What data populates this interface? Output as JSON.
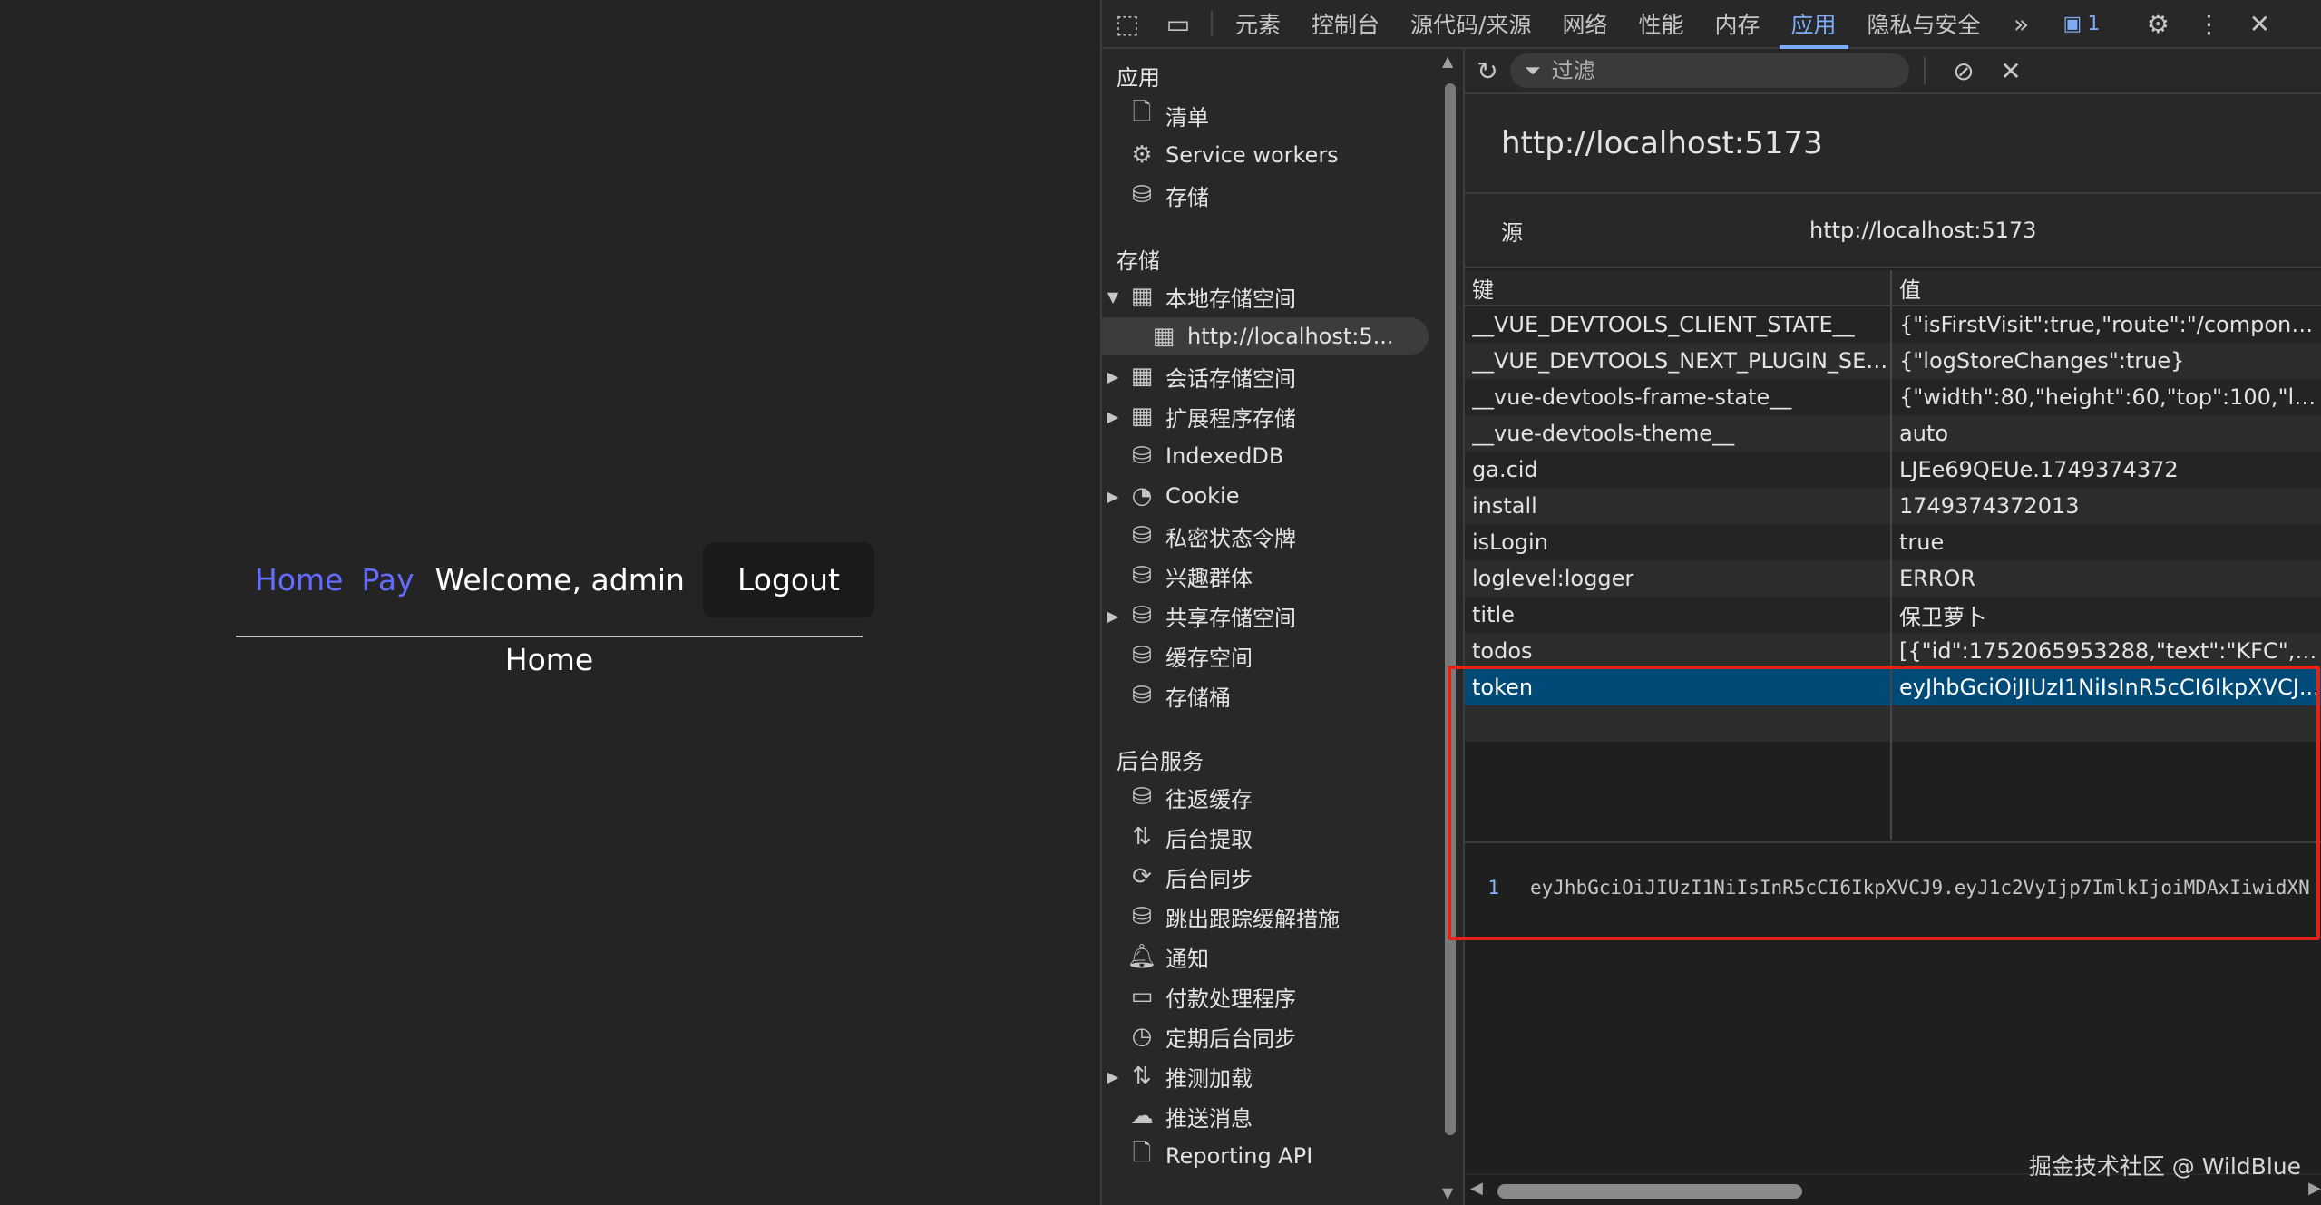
{
  "webpage": {
    "nav": {
      "home_link": "Home",
      "pay_link": "Pay",
      "welcome_text": "Welcome, admin",
      "logout_label": "Logout"
    },
    "heading": "Home",
    "colors": {
      "link": "#646cff",
      "background": "#242424",
      "button_bg": "#1a1a1a"
    }
  },
  "devtools": {
    "toolbar": {
      "inspect_icon": "inspect-element-icon",
      "device_icon": "device-toolbar-icon",
      "tabs": [
        "元素",
        "控制台",
        "源代码/来源",
        "网络",
        "性能",
        "内存",
        "应用",
        "隐私与安全"
      ],
      "active_tab": "应用",
      "more_tabs": "»",
      "issues_count": "1"
    },
    "sidebar": {
      "sections": [
        {
          "title": "应用",
          "items": [
            {
              "label": "清单",
              "icon": "file-icon"
            },
            {
              "label": "Service workers",
              "icon": "gears-icon"
            },
            {
              "label": "存储",
              "icon": "database-icon"
            }
          ]
        },
        {
          "title": "存储",
          "items": [
            {
              "label": "本地存储空间",
              "icon": "table-icon",
              "expanded": true
            },
            {
              "label": "http://localhost:5...",
              "icon": "table-icon",
              "selected": true
            },
            {
              "label": "会话存储空间",
              "icon": "table-icon"
            },
            {
              "label": "扩展程序存储",
              "icon": "table-icon"
            },
            {
              "label": "IndexedDB",
              "icon": "database-icon"
            },
            {
              "label": "Cookie",
              "icon": "cookie-icon"
            },
            {
              "label": "私密状态令牌",
              "icon": "database-icon"
            },
            {
              "label": "兴趣群体",
              "icon": "database-icon"
            },
            {
              "label": "共享存储空间",
              "icon": "database-icon"
            },
            {
              "label": "缓存空间",
              "icon": "database-icon"
            },
            {
              "label": "存储桶",
              "icon": "database-icon"
            }
          ]
        },
        {
          "title": "后台服务",
          "items": [
            {
              "label": "往返缓存",
              "icon": "database-icon"
            },
            {
              "label": "后台提取",
              "icon": "arrows-icon"
            },
            {
              "label": "后台同步",
              "icon": "sync-icon"
            },
            {
              "label": "跳出跟踪缓解措施",
              "icon": "database-icon"
            },
            {
              "label": "通知",
              "icon": "bell-icon"
            },
            {
              "label": "付款处理程序",
              "icon": "card-icon"
            },
            {
              "label": "定期后台同步",
              "icon": "clock-icon"
            },
            {
              "label": "推测加载",
              "icon": "arrows-icon"
            },
            {
              "label": "推送消息",
              "icon": "cloud-icon"
            },
            {
              "label": "Reporting API",
              "icon": "file-icon"
            }
          ]
        }
      ]
    },
    "filter": {
      "placeholder": "过滤"
    },
    "origin": {
      "title": "http://localhost:5173",
      "label": "源",
      "value": "http://localhost:5173"
    },
    "table": {
      "headers": {
        "key": "键",
        "value": "值"
      },
      "rows": [
        {
          "key": "__VUE_DEVTOOLS_CLIENT_STATE__",
          "value": "{\"isFirstVisit\":true,\"route\":\"/componen..."
        },
        {
          "key": "__VUE_DEVTOOLS_NEXT_PLUGIN_SET...",
          "value": "{\"logStoreChanges\":true}"
        },
        {
          "key": "__vue-devtools-frame-state__",
          "value": "{\"width\":80,\"height\":60,\"top\":100,\"left..."
        },
        {
          "key": "__vue-devtools-theme__",
          "value": "auto"
        },
        {
          "key": "ga.cid",
          "value": "LJEe69QEUe.1749374372"
        },
        {
          "key": "install",
          "value": "1749374372013"
        },
        {
          "key": "isLogin",
          "value": "true"
        },
        {
          "key": "loglevel:logger",
          "value": "ERROR"
        },
        {
          "key": "title",
          "value": "保卫萝卜"
        },
        {
          "key": "todos",
          "value": "[{\"id\":1752065953288,\"text\":\"KFC\",\"is..."
        },
        {
          "key": "token",
          "value": "eyJhbGciOiJIUzI1NiIsInR5cCI6IkpXVCJ...",
          "selected": true
        }
      ]
    },
    "preview": {
      "line_number": "1",
      "text": "eyJhbGciOiJIUzI1NiIsInR5cCI6IkpXVCJ9.eyJ1c2VyIjp7ImlkIjoiMDAxIiwidXN"
    },
    "highlight_color": "#e2231a"
  },
  "watermark": "掘金技术社区 @ WildBlue"
}
